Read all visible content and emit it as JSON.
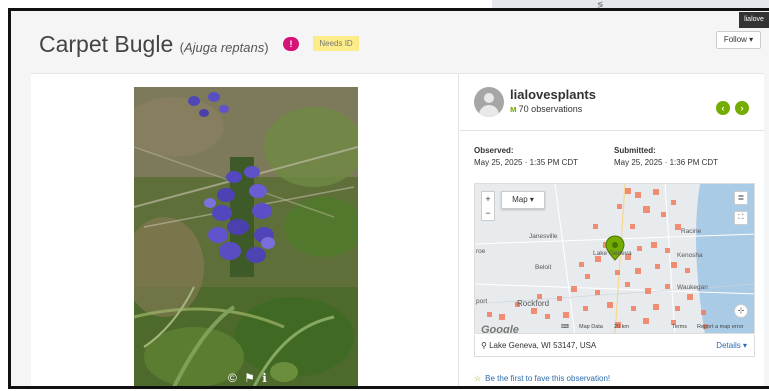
{
  "background": {
    "tooltip_text": "lialove"
  },
  "header": {
    "common_name": "Carpet Bugle",
    "scientific_name": "Ajuga reptans",
    "paren_open": "(",
    "paren_close": ")",
    "notification_count": "!",
    "status_badge": "Needs ID",
    "follow_button": "Follow ▾"
  },
  "photo": {
    "license_icons": "© ⚑ ℹ"
  },
  "observer": {
    "username": "lialovesplants",
    "observations": "70 observations",
    "prev_icon": "‹",
    "next_icon": "›"
  },
  "dates": {
    "observed_label": "Observed:",
    "observed_value": "May 25, 2025 · 1:35 PM CDT",
    "submitted_label": "Submitted:",
    "submitted_value": "May 25, 2025 · 1:36 PM CDT"
  },
  "map": {
    "type_button": "Map ▾",
    "zoom_in": "+",
    "zoom_out": "−",
    "labels": {
      "janesville": "Janesville",
      "beloit": "Beloit",
      "rockford": "Rockford",
      "racine": "Racine",
      "kenosha": "Kenosha",
      "waukegan": "Waukegan",
      "lake_geneva": "Lake Geneva",
      "port": "port",
      "roe": "roe"
    },
    "attribution": {
      "google": "Google",
      "map_data": "Map Data",
      "scale": "20 km",
      "terms": "Terms",
      "report": "Report a map error"
    },
    "accent_color": "#f27c5c"
  },
  "location": {
    "text": "Lake Geneva, WI 53147, USA",
    "details_link": "Details ▾"
  },
  "fave": {
    "text": "Be the first to fave this observation!"
  }
}
